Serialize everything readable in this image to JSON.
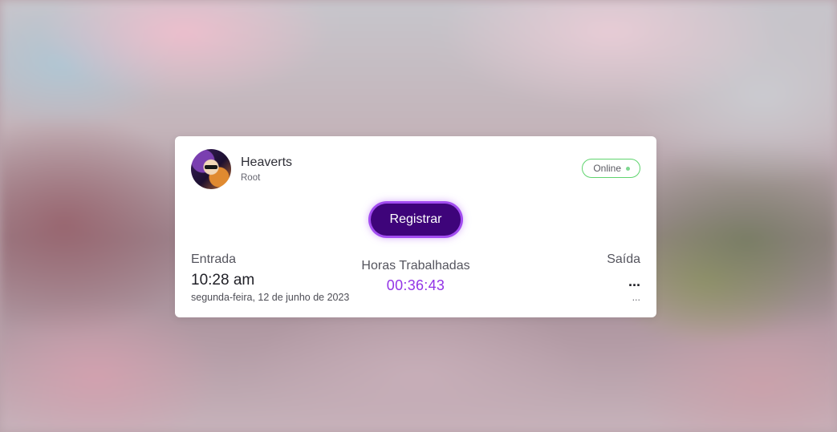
{
  "user": {
    "name": "Heaverts",
    "role": "Root",
    "avatar_icon": "user-avatar"
  },
  "status": {
    "label": "Online",
    "color": "#5fd46e"
  },
  "actions": {
    "register_label": "Registrar",
    "accent": "#3e047a"
  },
  "entry": {
    "label": "Entrada",
    "time": "10:28 am",
    "date": "segunda-feira, 12 de junho de 2023"
  },
  "hours": {
    "label": "Horas Trabalhadas",
    "value": "00:36:43",
    "color": "#9334e6"
  },
  "exit": {
    "label": "Saída",
    "time": "...",
    "date": "..."
  }
}
